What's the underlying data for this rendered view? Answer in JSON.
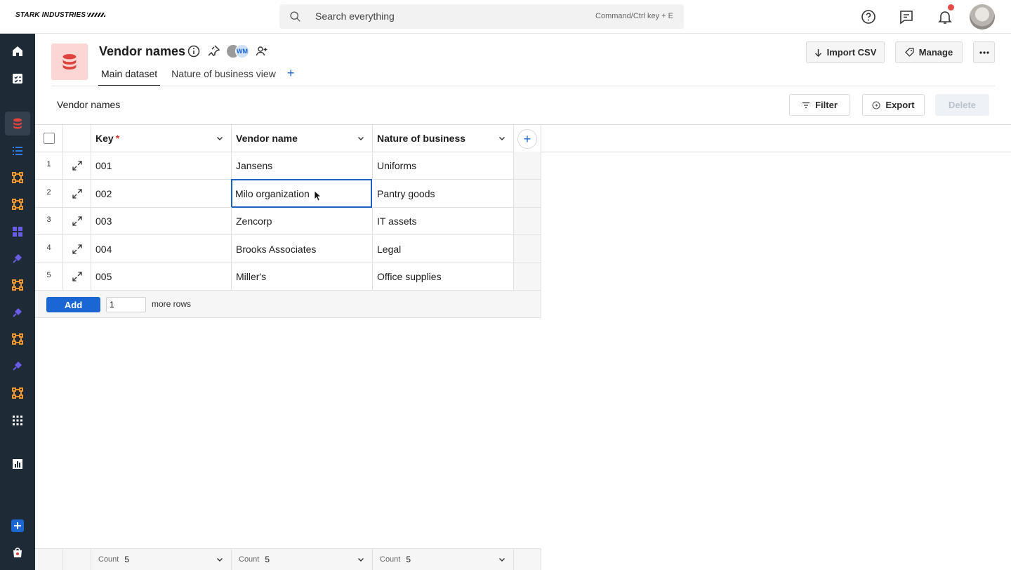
{
  "brand": {
    "logo_text": "STARK INDUSTRIES"
  },
  "search": {
    "placeholder": "Search everything",
    "shortcut": "Command/Ctrl key + E"
  },
  "header": {
    "title": "Vendor names",
    "collaborator_initials": "WM",
    "tabs": [
      {
        "label": "Main dataset",
        "active": true
      },
      {
        "label": "Nature of business view",
        "active": false
      }
    ],
    "import_label": "Import CSV",
    "manage_label": "Manage"
  },
  "grid": {
    "title": "Vendor names",
    "filter_label": "Filter",
    "export_label": "Export",
    "delete_label": "Delete",
    "columns": [
      {
        "label": "Key",
        "required": "*"
      },
      {
        "label": "Vendor name"
      },
      {
        "label": "Nature of business"
      }
    ],
    "rows": [
      {
        "num": "1",
        "key": "001",
        "vendor": "Jansens",
        "nature": "Uniforms"
      },
      {
        "num": "2",
        "key": "002",
        "vendor": "Milo organization",
        "nature": "Pantry goods"
      },
      {
        "num": "3",
        "key": "003",
        "vendor": "Zencorp",
        "nature": "IT assets"
      },
      {
        "num": "4",
        "key": "004",
        "vendor": "Brooks Associates",
        "nature": "Legal"
      },
      {
        "num": "5",
        "key": "005",
        "vendor": "Miller's",
        "nature": "Office supplies"
      }
    ],
    "add_button": "Add",
    "add_count": "1",
    "add_suffix": "more rows",
    "footer": [
      {
        "label": "Count",
        "value": "5"
      },
      {
        "label": "Count",
        "value": "5"
      },
      {
        "label": "Count",
        "value": "5"
      }
    ]
  },
  "colors": {
    "accent": "#1a66d2",
    "nav_bg": "#1e2a35",
    "dataset_icon": "#e0433e",
    "orange_icon": "#f0962e",
    "purple_icon": "#6b5ce6"
  }
}
